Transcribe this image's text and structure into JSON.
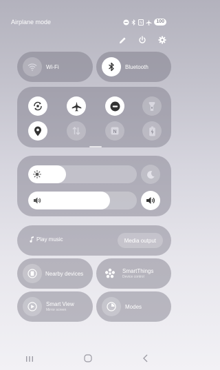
{
  "status_bar": {
    "mode_text": "Airplane mode",
    "battery": "100"
  },
  "quick_actions": [
    "pencil-icon",
    "power-icon",
    "settings-icon"
  ],
  "wifi": {
    "label": "Wi-Fi",
    "state": "off"
  },
  "bluetooth": {
    "label": "Bluetooth",
    "state": "on"
  },
  "toggle_grid": [
    {
      "name": "auto-rotate",
      "state": "on"
    },
    {
      "name": "airplane-mode",
      "state": "on"
    },
    {
      "name": "do-not-disturb",
      "state": "on"
    },
    {
      "name": "flashlight",
      "state": "off"
    },
    {
      "name": "location",
      "state": "on"
    },
    {
      "name": "mobile-data",
      "state": "off"
    },
    {
      "name": "nfc",
      "state": "off"
    },
    {
      "name": "power-saving",
      "state": "off"
    }
  ],
  "brightness": {
    "level": 0.35
  },
  "volume": {
    "level": 0.75
  },
  "media": {
    "play_label": "Play music",
    "output_label": "Media output"
  },
  "nearby": {
    "label": "Nearby devices"
  },
  "smartthings": {
    "label": "SmartThings",
    "sub": "Device control"
  },
  "smartview": {
    "label": "Smart View",
    "sub": "Mirror screen"
  },
  "modes": {
    "label": "Modes"
  },
  "colors": {
    "accent_on": "#ffffff",
    "panel": "#706e7c"
  }
}
